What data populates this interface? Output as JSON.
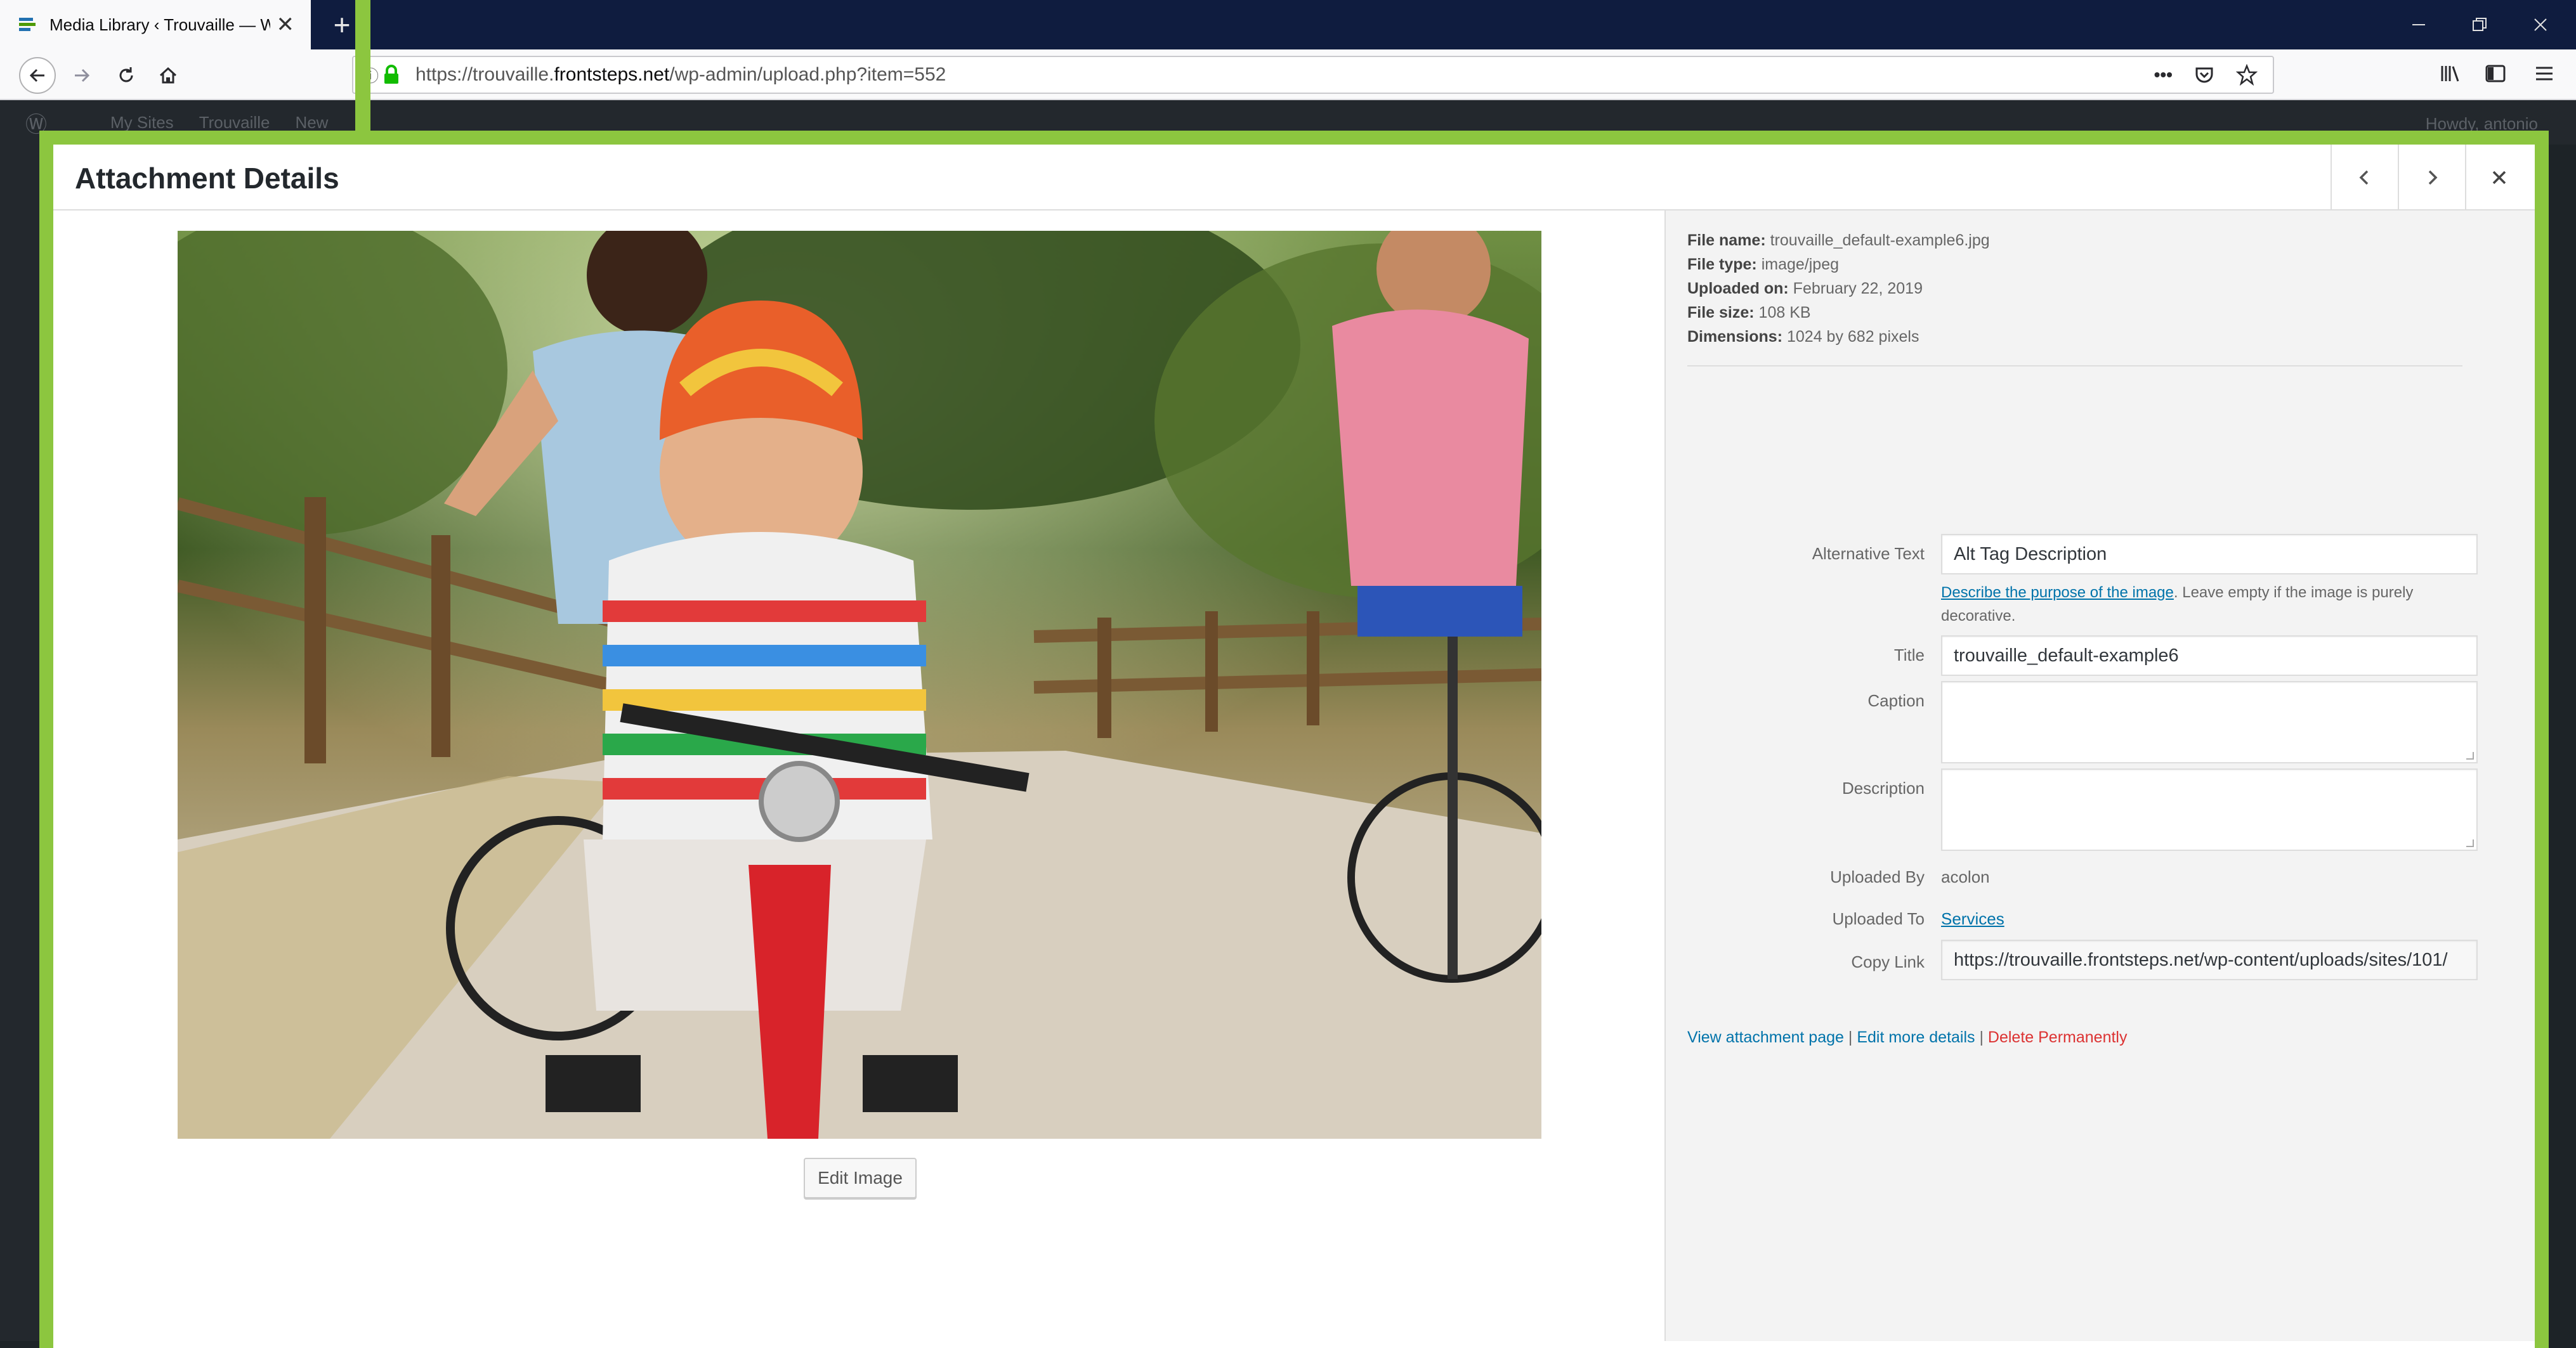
{
  "browser": {
    "tab_title": "Media Library ‹ Trouvaille — W",
    "new_tab": "+",
    "url_prefix": "https://trouvaille.",
    "url_host": "frontsteps.net",
    "url_path": "/wp-admin/upload.php?item=552",
    "url_more": "•••"
  },
  "wp_admin_bar": {
    "my_sites": "My Sites",
    "site_name": "Trouvaille",
    "new_label": "New",
    "howdy": "Howdy, antonio"
  },
  "modal": {
    "title": "Attachment Details",
    "edit_image": "Edit Image"
  },
  "file_info": {
    "file_name_label": "File name:",
    "file_name": "trouvaille_default-example6.jpg",
    "file_type_label": "File type:",
    "file_type": "image/jpeg",
    "uploaded_on_label": "Uploaded on:",
    "uploaded_on": "February 22, 2019",
    "file_size_label": "File size:",
    "file_size": "108 KB",
    "dimensions_label": "Dimensions:",
    "dimensions": "1024 by 682 pixels"
  },
  "fields": {
    "alt_label": "Alternative Text",
    "alt_value": "Alt Tag Description",
    "alt_help_link": "Describe the purpose of the image",
    "alt_help_rest": ". Leave empty if the image is purely decorative.",
    "title_label": "Title",
    "title_value": "trouvaille_default-example6",
    "caption_label": "Caption",
    "caption_value": "",
    "description_label": "Description",
    "description_value": "",
    "uploaded_by_label": "Uploaded By",
    "uploaded_by": "acolon",
    "uploaded_to_label": "Uploaded To",
    "uploaded_to": "Services",
    "copy_link_label": "Copy Link",
    "copy_link": "https://trouvaille.frontsteps.net/wp-content/uploads/sites/101/"
  },
  "actions": {
    "view": "View attachment page",
    "sep": " | ",
    "edit": "Edit more details",
    "delete": "Delete Permanently"
  },
  "colors": {
    "highlight_frame": "#8cc63f",
    "link": "#0073aa",
    "delete": "#dc3232",
    "tab_bar": "#0f1c3f",
    "admin_bar": "#23282d"
  }
}
